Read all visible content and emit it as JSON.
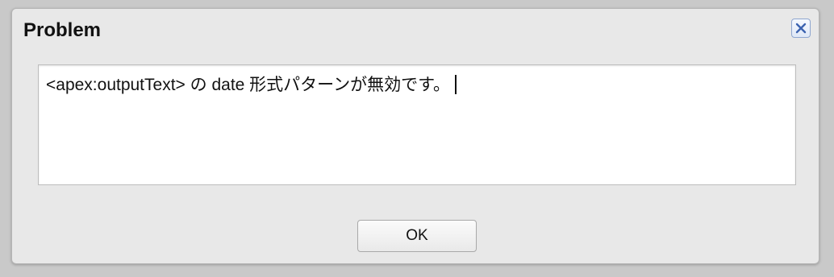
{
  "dialog": {
    "title": "Problem",
    "close_icon": "close-icon",
    "message": "<apex:outputText> の date 形式パターンが無効です。",
    "ok_label": "OK"
  },
  "colors": {
    "dialog_background": "#e8e8e8",
    "close_icon_stroke": "#3c63b0",
    "message_background": "#ffffff"
  }
}
